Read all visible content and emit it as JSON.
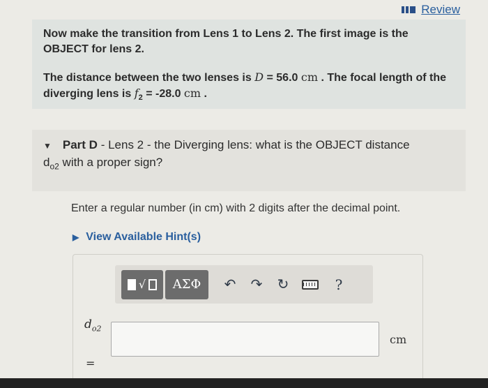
{
  "review": {
    "label": "Review",
    "icon": "review-icon"
  },
  "intro": {
    "line1": "Now make the transition from Lens 1 to Lens 2. The first image is the OBJECT for lens 2.",
    "dist_pre": "The distance between the two lenses is",
    "dist_var": "D",
    "dist_eq": " = 56.0 ",
    "dist_unit": "cm",
    "dist_post": " . The focal length of the diverging lens is",
    "f_var": "f",
    "f_sub": "2",
    "f_eq": " = -28.0 ",
    "f_unit": "cm",
    "f_post": " ."
  },
  "part": {
    "label": "Part D",
    "text": " - Lens 2 - the Diverging lens: what is the OBJECT distance",
    "var": "d",
    "var_sub": "o2",
    "text2": " with a proper sign?"
  },
  "instruction": "Enter a regular number (in cm) with 2 digits after the decimal point.",
  "hint": {
    "label": "View Available Hint(s)"
  },
  "toolbar": {
    "templates_icon": "templates-icon",
    "symbols_label": "ΑΣΦ",
    "undo_icon": "undo-icon",
    "redo_icon": "redo-icon",
    "reset_icon": "reset-icon",
    "keyboard_icon": "keyboard-icon",
    "help_label": "?"
  },
  "answer": {
    "var": "d",
    "var_sub": "o2",
    "equals": "=",
    "value": "",
    "unit": "cm"
  }
}
